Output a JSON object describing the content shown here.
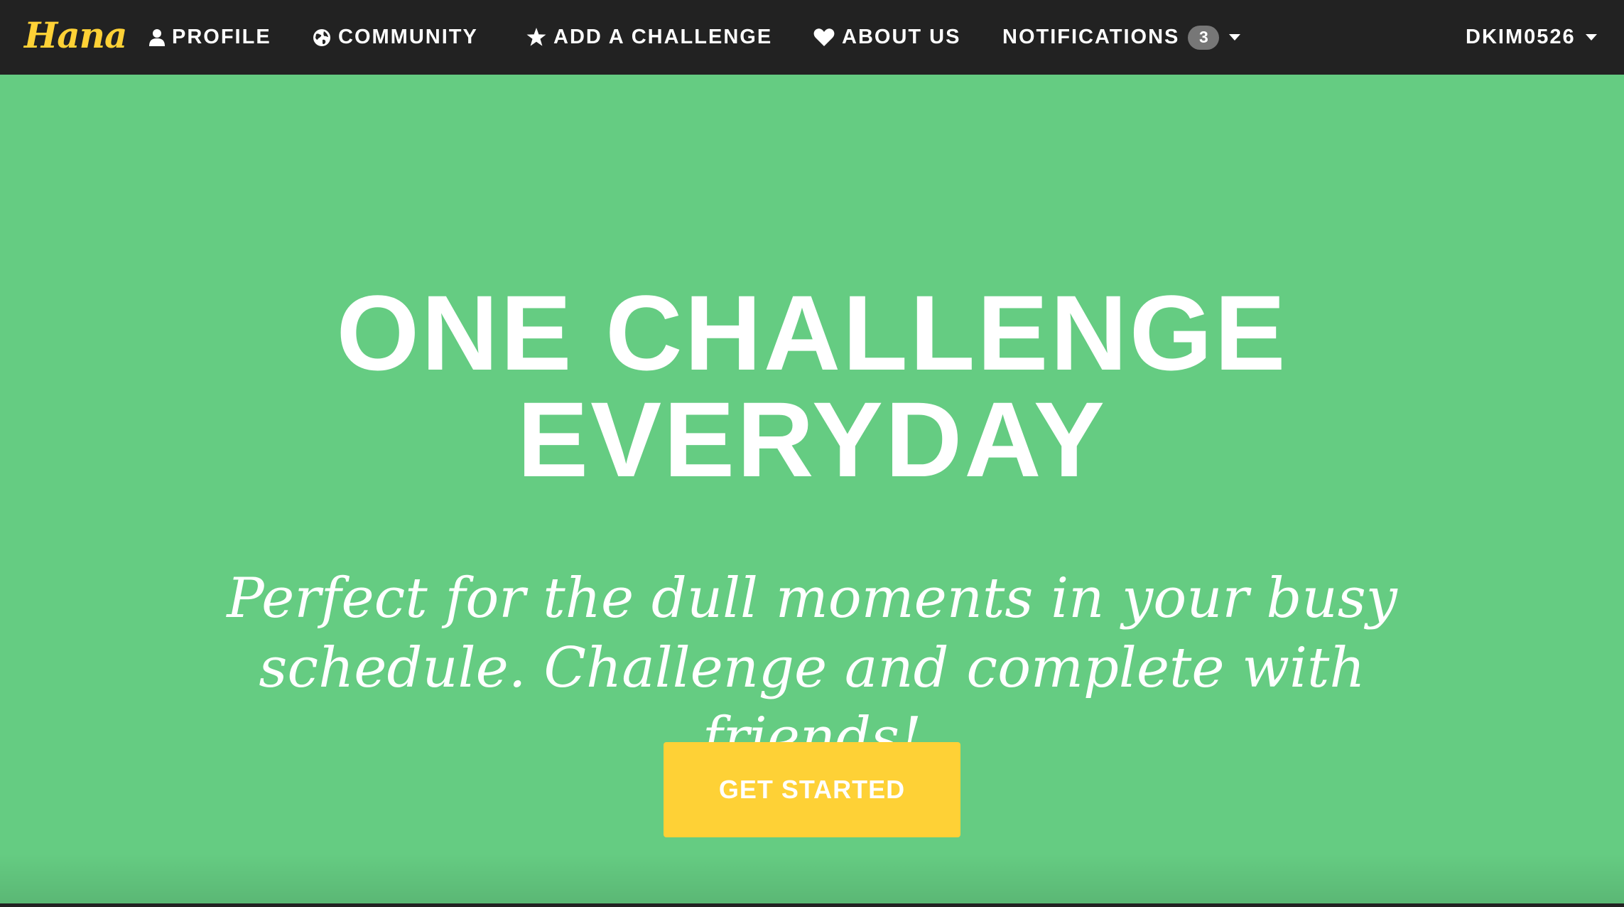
{
  "nav": {
    "brand": "Hana",
    "items": [
      {
        "label": "PROFILE",
        "icon": "user-icon"
      },
      {
        "label": "COMMUNITY",
        "icon": "globe-icon"
      },
      {
        "label": "ADD A CHALLENGE",
        "icon": "star-icon"
      },
      {
        "label": "ABOUT US",
        "icon": "heart-icon"
      }
    ],
    "notifications": {
      "label": "NOTIFICATIONS",
      "count": "3"
    },
    "user": {
      "label": "DKIM0526"
    }
  },
  "hero": {
    "heading_line1": "ONE CHALLENGE",
    "heading_line2": "EVERYDAY",
    "subtitle": "Perfect for the dull moments in your busy schedule. Challenge and complete with friends!",
    "cta_label": "GET STARTED"
  },
  "colors": {
    "navbar_bg": "#222222",
    "hero_bg": "#65cc82",
    "brand_accent": "#fed136",
    "badge_bg": "#777777",
    "text": "#ffffff"
  }
}
